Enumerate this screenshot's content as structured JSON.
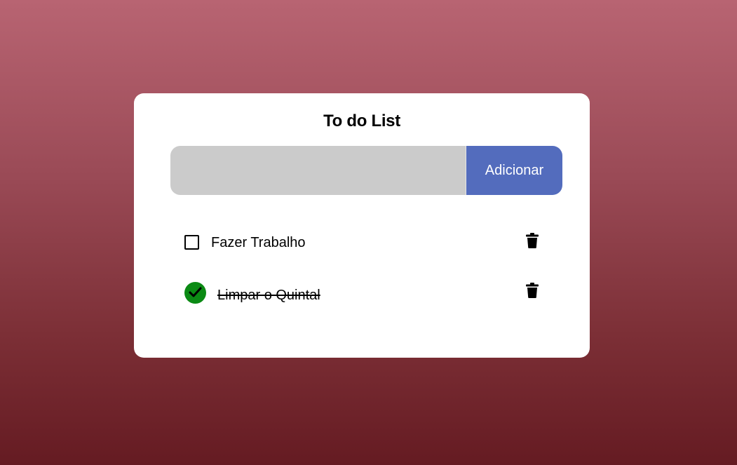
{
  "app": {
    "title": "To do List"
  },
  "input": {
    "value": "",
    "placeholder": ""
  },
  "add_button": {
    "label": "Adicionar",
    "color": "#536cbd"
  },
  "tasks": [
    {
      "label": "Fazer Trabalho",
      "done": false,
      "icon": "checkbox-empty-icon",
      "delete_icon": "trash-icon"
    },
    {
      "label": "Limpar o Quintal",
      "done": true,
      "icon": "check-circle-icon",
      "done_color": "#0b8a14",
      "delete_icon": "trash-icon"
    }
  ],
  "colors": {
    "card": "#ffffff",
    "input_background": "#cbcbcb",
    "background_top": "#b86472",
    "background_bottom": "#651b22"
  }
}
